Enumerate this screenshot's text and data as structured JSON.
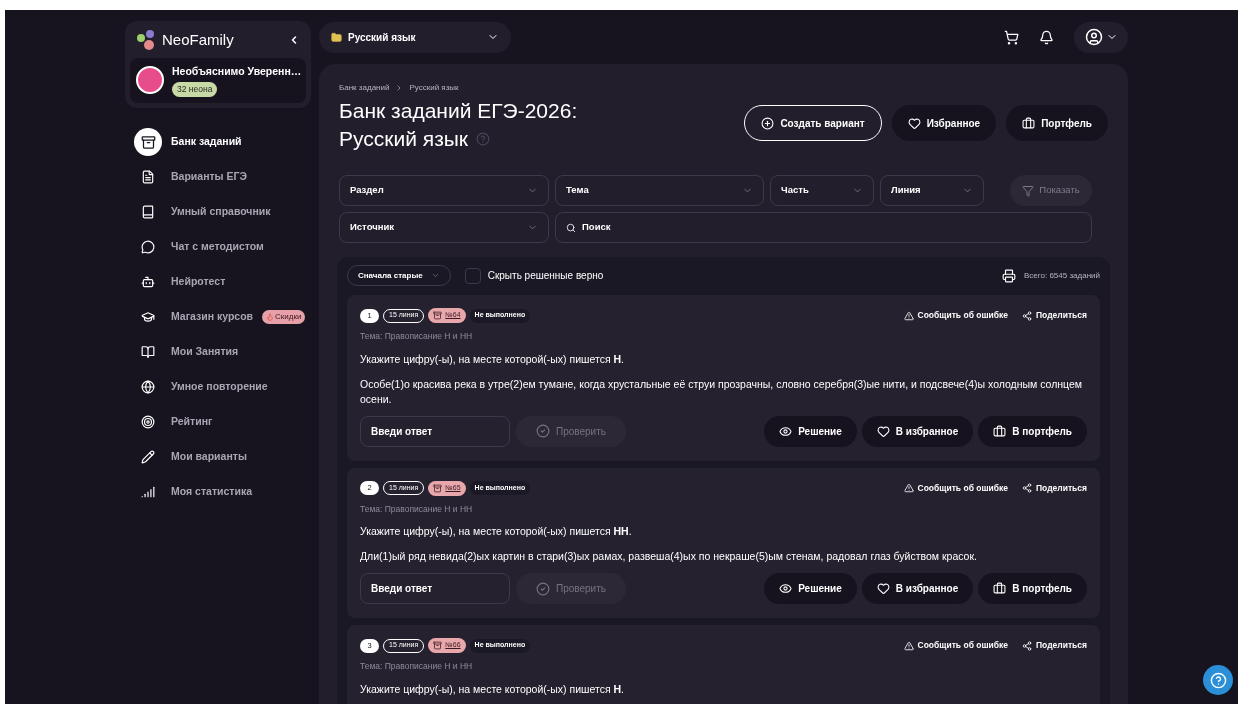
{
  "sidebar": {
    "logo": "NeoFamily",
    "user": {
      "name": "Необъяснимо Уверенн…",
      "balance": "32 неона"
    },
    "items": [
      {
        "label": "Банк заданий",
        "selected": true
      },
      {
        "label": "Варианты ЕГЭ",
        "selected": false
      },
      {
        "label": "Умный справочник",
        "selected": false
      },
      {
        "label": "Чат с методистом",
        "selected": false
      },
      {
        "label": "Нейротест",
        "selected": false
      },
      {
        "label": "Магазин курсов",
        "selected": false,
        "badge": "Скидки"
      },
      {
        "label": "Мои Занятия",
        "selected": false
      },
      {
        "label": "Умное повторение",
        "selected": false
      },
      {
        "label": "Рейтинг",
        "selected": false
      },
      {
        "label": "Мои варианты",
        "selected": false
      },
      {
        "label": "Моя статистика",
        "selected": false
      }
    ]
  },
  "topbar": {
    "subject": "Русский язык"
  },
  "header": {
    "breadcrumbs": [
      "Банк заданий",
      "Русский язык"
    ],
    "title_lines": [
      "Банк заданий ЕГЭ-2026:",
      "Русский язык"
    ],
    "actions": [
      {
        "kind": "create",
        "label": "Создать вариант"
      },
      {
        "kind": "favorites",
        "label": "Избранное"
      },
      {
        "kind": "portfolio",
        "label": "Портфель"
      }
    ]
  },
  "filters": [
    {
      "kind": "select",
      "label": "Раздел"
    },
    {
      "kind": "select",
      "label": "Тема"
    },
    {
      "kind": "select",
      "label": "Часть"
    },
    {
      "kind": "select",
      "label": "Линия"
    },
    {
      "kind": "button",
      "label": "Показать",
      "disabled": true
    },
    {
      "kind": "select",
      "label": "Источник"
    },
    {
      "kind": "search",
      "label": "Поиск"
    }
  ],
  "toolbar": {
    "sort": "Сначала старые",
    "hide_solved": {
      "label": "Скрыть решенные верно",
      "checked": false
    },
    "total": "Всего: 6545 заданий"
  },
  "tasks": [
    {
      "number": "1",
      "line": "15 линия",
      "code": "№64",
      "status": "Не выполнено",
      "report": "Сообщить об ошибке",
      "share": "Поделиться",
      "topic": "Тема: Правописание Н и НН",
      "question": "Укажите цифру(-ы), на месте которой(-ых) пишется **Н**.",
      "text": "Особе(1)о красива река в утре(2)ем тумане, когда хрустальные её струи прозрачны, словно серебря(3)ые нити, и подсвече(4)ы холодным солнцем осени.",
      "answer_placeholder": "Введи ответ",
      "check": {
        "label": "Проверить",
        "disabled": true
      },
      "actions": [
        "Решение",
        "В избранное",
        "В портфель"
      ]
    },
    {
      "number": "2",
      "line": "15 линия",
      "code": "№65",
      "status": "Не выполнено",
      "report": "Сообщить об ошибке",
      "share": "Поделиться",
      "topic": "Тема: Правописание Н и НН",
      "question": "Укажите цифру(-ы), на месте которой(-ых) пишется **НН**.",
      "text": "Дли(1)ый ряд невида(2)ых картин в стари(3)ых рамах, развеша(4)ых по некраше(5)ым стенам, радовал глаз буйством красок.",
      "answer_placeholder": "Введи ответ",
      "check": {
        "label": "Проверить",
        "disabled": true
      },
      "actions": [
        "Решение",
        "В избранное",
        "В портфель"
      ]
    },
    {
      "number": "3",
      "line": "15 линия",
      "code": "№66",
      "status": "Не выполнено",
      "report": "Сообщить об ошибке",
      "share": "Поделиться",
      "topic": "Тема: Правописание Н и НН",
      "question": "Укажите цифру(-ы), на месте которой(-ых) пишется **Н**."
    }
  ]
}
